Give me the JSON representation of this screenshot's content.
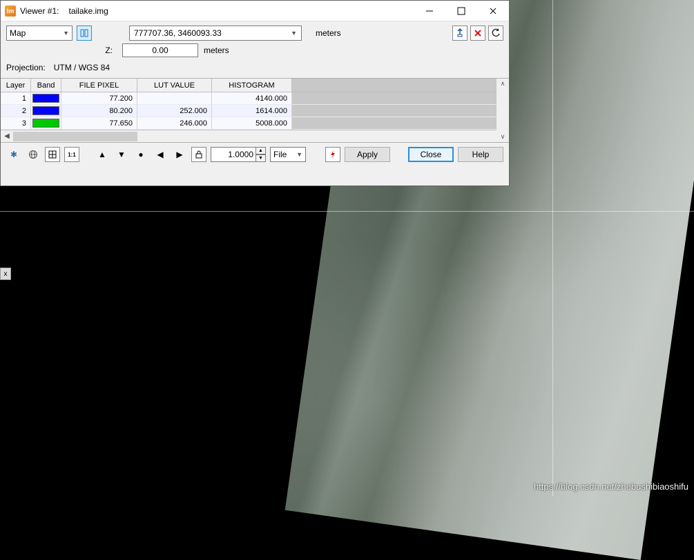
{
  "titlebar": {
    "app_abbr": "Im",
    "title": "Viewer #1:",
    "filename": "tailake.img"
  },
  "top": {
    "map_label": "Map",
    "coordinates": "777707.36, 3460093.33",
    "units": "meters",
    "z_label": "Z:",
    "z_value": "0.00",
    "z_units": "meters"
  },
  "projection": {
    "label": "Projection:",
    "value": "UTM / WGS 84"
  },
  "table": {
    "headers": {
      "layer": "Layer",
      "band": "Band",
      "file": "FILE PIXEL",
      "lut": "LUT VALUE",
      "hist": "HISTOGRAM"
    },
    "rows": [
      {
        "layer": "1",
        "band_color": "#0000ff",
        "file": "77.200",
        "lut": "",
        "hist": "4140.000"
      },
      {
        "layer": "2",
        "band_color": "#0000ff",
        "file": "80.200",
        "lut": "252.000",
        "hist": "1614.000"
      },
      {
        "layer": "3",
        "band_color": "#00c800",
        "file": "77.650",
        "lut": "246.000",
        "hist": "5008.000"
      }
    ]
  },
  "bottom": {
    "zoom": "1.0000",
    "file_label": "File",
    "apply": "Apply",
    "close": "Close",
    "help": "Help"
  },
  "watermark": "https://blog.csdn.net/zhebushibiaoshifu",
  "side_close": "x"
}
